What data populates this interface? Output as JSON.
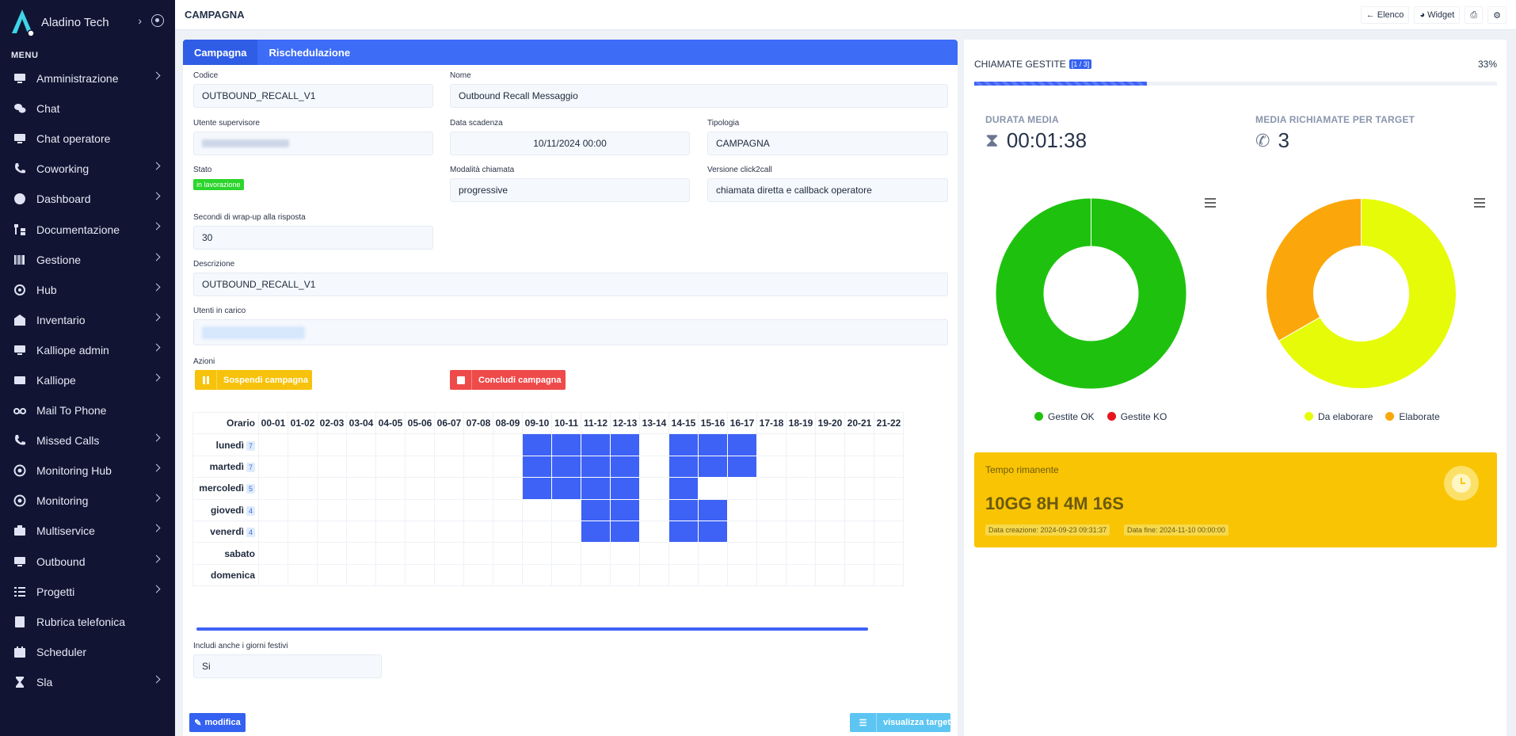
{
  "brand": {
    "name": "Aladino Tech"
  },
  "sidebar": {
    "menu_title": "MENU",
    "items": [
      {
        "label": "Amministrazione",
        "icon": "monitor-icon",
        "chevron": true
      },
      {
        "label": "Chat",
        "icon": "chat-bubbles-icon",
        "chevron": false
      },
      {
        "label": "Chat operatore",
        "icon": "monitor-icon",
        "chevron": false
      },
      {
        "label": "Coworking",
        "icon": "phone-icon",
        "chevron": true
      },
      {
        "label": "Dashboard",
        "icon": "globe-icon",
        "chevron": true
      },
      {
        "label": "Documentazione",
        "icon": "sitemap-icon",
        "chevron": true
      },
      {
        "label": "Gestione",
        "icon": "barcode-icon",
        "chevron": true
      },
      {
        "label": "Hub",
        "icon": "at-icon",
        "chevron": true
      },
      {
        "label": "Inventario",
        "icon": "warehouse-icon",
        "chevron": true
      },
      {
        "label": "Kalliope admin",
        "icon": "monitor-icon",
        "chevron": true
      },
      {
        "label": "Kalliope",
        "icon": "id-card-icon",
        "chevron": true
      },
      {
        "label": "Mail To Phone",
        "icon": "voicemail-icon",
        "chevron": false
      },
      {
        "label": "Missed Calls",
        "icon": "phone-slash-icon",
        "chevron": true
      },
      {
        "label": "Monitoring Hub",
        "icon": "target-icon",
        "chevron": true
      },
      {
        "label": "Monitoring",
        "icon": "target-icon",
        "chevron": true
      },
      {
        "label": "Multiservice",
        "icon": "briefcase-icon",
        "chevron": true
      },
      {
        "label": "Outbound",
        "icon": "monitor-icon",
        "chevron": true
      },
      {
        "label": "Progetti",
        "icon": "list-check-icon",
        "chevron": true
      },
      {
        "label": "Rubrica telefonica",
        "icon": "address-book-icon",
        "chevron": false
      },
      {
        "label": "Scheduler",
        "icon": "calendar-icon",
        "chevron": false
      },
      {
        "label": "Sla",
        "icon": "hourglass-icon",
        "chevron": true
      }
    ]
  },
  "header": {
    "title": "CAMPAGNA",
    "elenco": "Elenco",
    "widget": "Widget"
  },
  "tabs": [
    "Campagna",
    "Rischedulazione"
  ],
  "form": {
    "codice_label": "Codice",
    "codice": "OUTBOUND_RECALL_V1",
    "nome_label": "Nome",
    "nome": "Outbound Recall Messaggio",
    "supervisore_label": "Utente supervisore",
    "scadenza_label": "Data scadenza",
    "scadenza": "10/11/2024 00:00",
    "tipologia_label": "Tipologia",
    "tipologia": "CAMPAGNA",
    "stato_label": "Stato",
    "stato": "in lavorazione",
    "modalita_label": "Modalità chiamata",
    "modalita": "progressive",
    "versione_label": "Versione click2call",
    "versione": "chiamata diretta e callback operatore",
    "wrapup_label": "Secondi di wrap-up alla risposta",
    "wrapup": "30",
    "descrizione_label": "Descrizione",
    "descrizione": "OUTBOUND_RECALL_V1",
    "utenti_label": "Utenti in carico",
    "azioni_label": "Azioni",
    "sospendi": "Sospendi campagna",
    "concludi": "Concludi campagna",
    "festivi_label": "Includi anche i giorni festivi",
    "festivi": "Si"
  },
  "schedule": {
    "corner": "Orario",
    "hours": [
      "00-01",
      "01-02",
      "02-03",
      "03-04",
      "04-05",
      "05-06",
      "06-07",
      "07-08",
      "08-09",
      "09-10",
      "10-11",
      "11-12",
      "12-13",
      "13-14",
      "14-15",
      "15-16",
      "16-17",
      "17-18",
      "18-19",
      "19-20",
      "20-21",
      "21-22"
    ],
    "days": [
      {
        "name": "lunedì",
        "count": "7",
        "active": [
          9,
          10,
          11,
          12,
          14,
          15,
          16
        ]
      },
      {
        "name": "martedì",
        "count": "7",
        "active": [
          9,
          10,
          11,
          12,
          14,
          15,
          16
        ]
      },
      {
        "name": "mercoledì",
        "count": "5",
        "active": [
          9,
          10,
          11,
          12,
          14
        ]
      },
      {
        "name": "giovedì",
        "count": "4",
        "active": [
          11,
          12,
          14,
          15
        ]
      },
      {
        "name": "venerdì",
        "count": "4",
        "active": [
          11,
          12,
          14,
          15
        ]
      },
      {
        "name": "sabato",
        "count": "",
        "active": []
      },
      {
        "name": "domenica",
        "count": "",
        "active": []
      }
    ]
  },
  "footer": {
    "modifica": "modifica",
    "visualizza": "visualizza target"
  },
  "stats": {
    "gestite_label": "CHIAMATE GESTITE",
    "gestite_badge": "[1 / 3]",
    "gestite_percent": "33%",
    "gestite_progress": 0.33,
    "durata_label": "DURATA MEDIA",
    "durata": "00:01:38",
    "media_label": "MEDIA RICHIAMATE PER TARGET",
    "media": "3"
  },
  "chart_data": [
    {
      "type": "pie",
      "categories": [
        "Gestite OK",
        "Gestite KO"
      ],
      "values": [
        100,
        0
      ],
      "colors": [
        "#1ec20e",
        "#e8141c"
      ],
      "legend": "bottom"
    },
    {
      "type": "pie",
      "categories": [
        "Da elaborare",
        "Elaborate"
      ],
      "values": [
        66.7,
        33.3
      ],
      "colors": [
        "#e6fb08",
        "#fba70b"
      ],
      "legend": "bottom"
    }
  ],
  "tempo": {
    "label": "Tempo rimanente",
    "value": "10GG 8H 4M 16S",
    "creazione": "Data creazione: 2024-09-23 09:31:37",
    "fine": "Data fine: 2024-11-10 00:00:00"
  }
}
